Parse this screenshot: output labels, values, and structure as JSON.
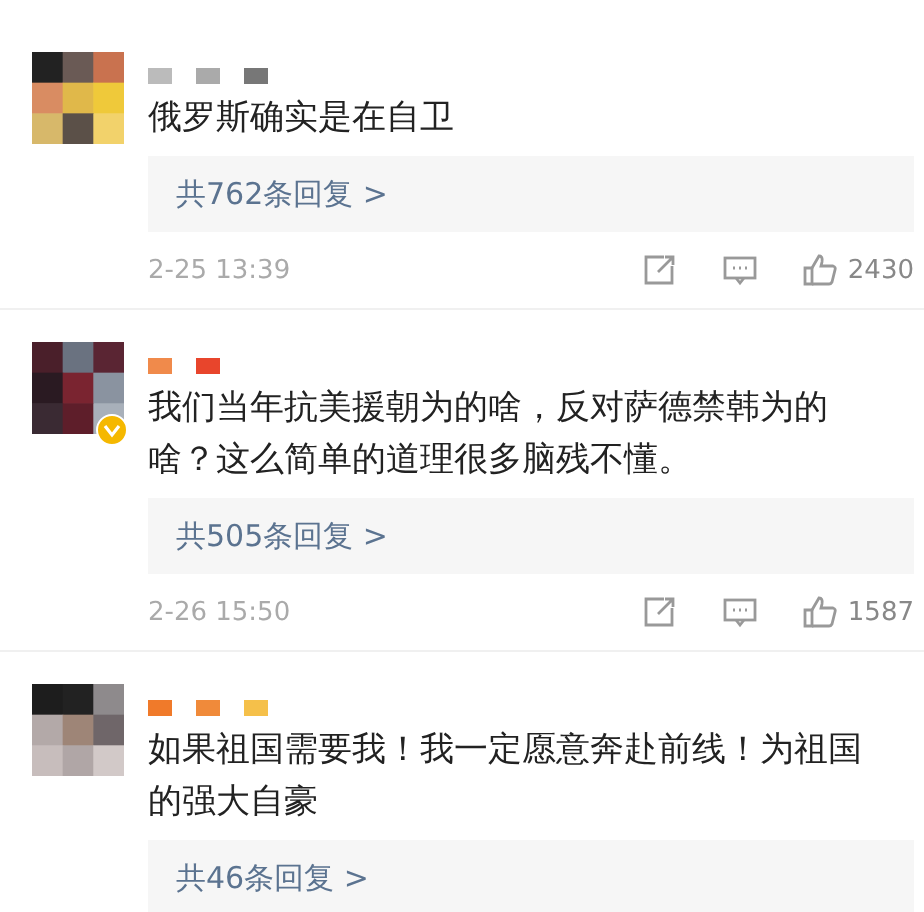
{
  "comments": [
    {
      "verified": false,
      "text": "俄罗斯确实是在自卫",
      "replies": "共762条回复 >",
      "time": "2-25 13:39",
      "likes": "2430"
    },
    {
      "verified": true,
      "text": "我们当年抗美援朝为的啥，反对萨德禁韩为的啥？这么简单的道理很多脑残不懂。",
      "replies": "共505条回复 >",
      "time": "2-26 15:50",
      "likes": "1587"
    },
    {
      "verified": false,
      "text": "如果祖国需要我！我一定愿意奔赴前线！为祖国的强大自豪",
      "replies": "共46条回复 >"
    }
  ]
}
